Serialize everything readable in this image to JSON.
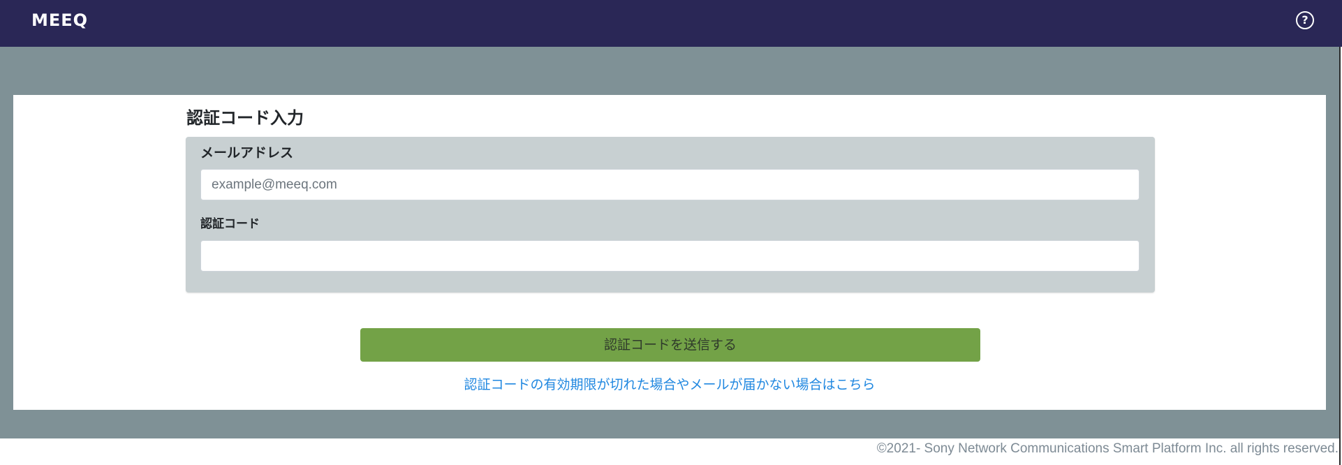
{
  "header": {
    "logo": "MEEQ",
    "help_icon": "question-circle-icon",
    "help_glyph": "?"
  },
  "form": {
    "title": "認証コード入力",
    "email_label": "メールアドレス",
    "email_placeholder": "example@meeq.com",
    "email_value": "",
    "code_label": "認証コード",
    "code_value": "",
    "submit_label": "認証コードを送信する",
    "help_link": "認証コードの有効期限が切れた場合やメールが届かない場合はこちら"
  },
  "footer": {
    "copyright": "©2021- Sony Network Communications Smart Platform Inc. all rights reserved."
  },
  "colors": {
    "header_bg": "#2a2756",
    "backdrop": "#7f9196",
    "panel": "#c8d0d2",
    "submit": "#73a247",
    "link": "#1f87e0"
  }
}
